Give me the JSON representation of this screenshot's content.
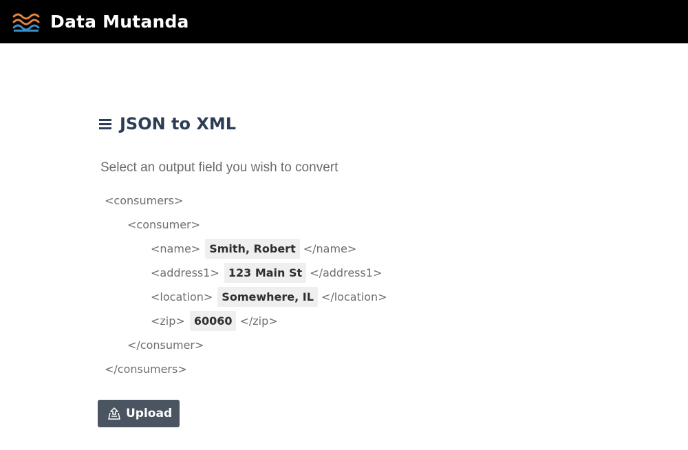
{
  "header": {
    "app_title": "Data Mutanda",
    "logo_icon": "waves-logo-icon",
    "logo_colors": [
      "#e8823a",
      "#3a8fc8"
    ]
  },
  "main": {
    "title": "JSON to XML",
    "title_icon": "menu-lines-icon",
    "instructions": "Select an output field you wish to convert"
  },
  "xml": {
    "consumers_open": "<consumers>",
    "consumer_open": "<consumer>",
    "fields": [
      {
        "open": "<name>",
        "value": "Smith, Robert",
        "close": "</name>"
      },
      {
        "open": "<address1>",
        "value": "123 Main St",
        "close": "</address1>"
      },
      {
        "open": "<location>",
        "value": "Somewhere, IL",
        "close": "</location>"
      },
      {
        "open": "<zip>",
        "value": "60060",
        "close": "</zip>"
      }
    ],
    "consumer_close": "</consumer>",
    "consumers_close": "</consumers>"
  },
  "upload": {
    "label": "Upload",
    "icon": "upload-icon"
  },
  "colors": {
    "header_bg": "#000000",
    "title_color": "#2c3e55",
    "button_bg": "#4b5562",
    "field_bg": "#efefef"
  }
}
